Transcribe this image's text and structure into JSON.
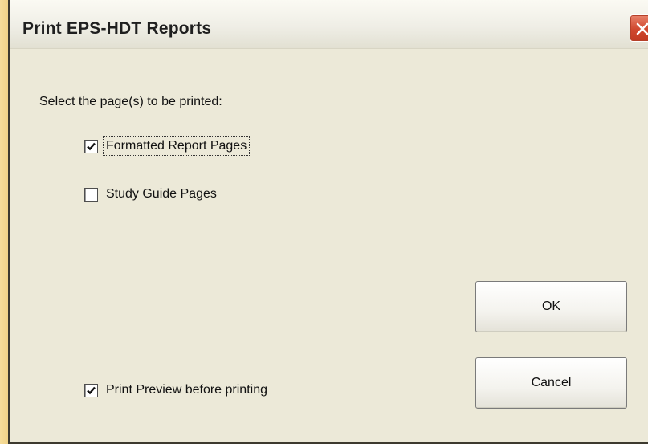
{
  "window": {
    "title": "Print EPS-HDT Reports",
    "close_icon": "close-icon"
  },
  "content": {
    "prompt": "Select the page(s) to be printed:",
    "options": [
      {
        "label": "Formatted Report Pages",
        "checked": true,
        "focused": true
      },
      {
        "label": "Study Guide Pages",
        "checked": false,
        "focused": false
      }
    ],
    "print_preview": {
      "label": "Print Preview before printing",
      "checked": true
    }
  },
  "buttons": {
    "ok_label": "OK",
    "cancel_label": "Cancel"
  },
  "colors": {
    "dialog_background": "#ece9d8",
    "desktop_background": "#f4d98e",
    "close_button": "#d0482e"
  }
}
